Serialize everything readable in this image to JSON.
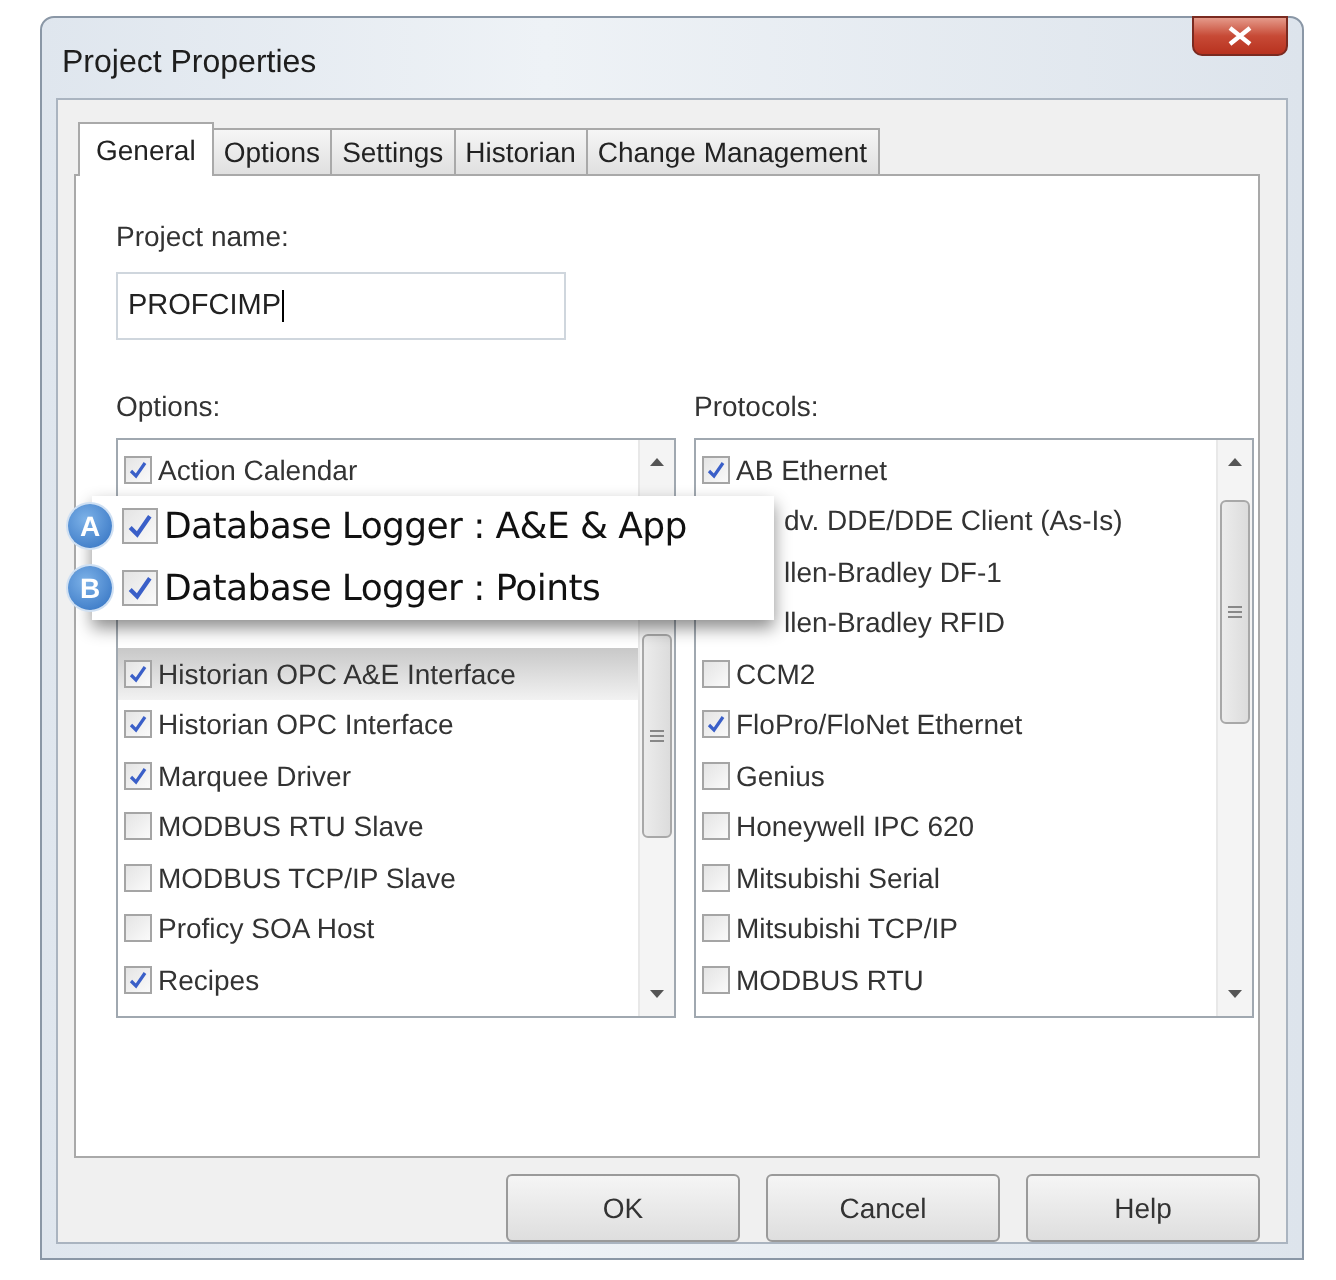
{
  "window": {
    "title": "Project Properties"
  },
  "tabs": [
    {
      "label": "General",
      "selected": true
    },
    {
      "label": "Options",
      "selected": false
    },
    {
      "label": "Settings",
      "selected": false
    },
    {
      "label": "Historian",
      "selected": false
    },
    {
      "label": "Change Management",
      "selected": false
    }
  ],
  "project_name": {
    "label": "Project name:",
    "value": "PROFCIMP"
  },
  "options": {
    "label": "Options:",
    "items": [
      {
        "kind": "item",
        "label": "Action Calendar",
        "checked": true
      },
      {
        "kind": "callout",
        "entries": [
          {
            "badge": "A",
            "label": "Database Logger : A&E & App",
            "checked": true
          },
          {
            "badge": "B",
            "label": "Database Logger : Points",
            "checked": true
          }
        ]
      },
      {
        "kind": "item",
        "label": "Historian OPC A&E Interface",
        "checked": true,
        "shaded": true
      },
      {
        "kind": "item",
        "label": "Historian OPC Interface",
        "checked": true
      },
      {
        "kind": "item",
        "label": "Marquee Driver",
        "checked": true
      },
      {
        "kind": "item",
        "label": "MODBUS RTU Slave",
        "checked": false
      },
      {
        "kind": "item",
        "label": "MODBUS TCP/IP Slave",
        "checked": false
      },
      {
        "kind": "item",
        "label": "Proficy SOA Host",
        "checked": false
      },
      {
        "kind": "item",
        "label": "Recipes",
        "checked": true
      }
    ]
  },
  "protocols": {
    "label": "Protocols:",
    "items": [
      {
        "kind": "item",
        "label": "AB Ethernet",
        "checked": true
      },
      {
        "kind": "covered",
        "label": "dv. DDE/DDE Client (As-Is)"
      },
      {
        "kind": "covered",
        "label": "llen-Bradley DF-1"
      },
      {
        "kind": "covered",
        "label": "llen-Bradley RFID"
      },
      {
        "kind": "item",
        "label": "CCM2",
        "checked": false
      },
      {
        "kind": "item",
        "label": "FloPro/FloNet Ethernet",
        "checked": true
      },
      {
        "kind": "item",
        "label": "Genius",
        "checked": false
      },
      {
        "kind": "item",
        "label": "Honeywell IPC 620",
        "checked": false
      },
      {
        "kind": "item",
        "label": "Mitsubishi Serial",
        "checked": false
      },
      {
        "kind": "item",
        "label": "Mitsubishi TCP/IP",
        "checked": false
      },
      {
        "kind": "item",
        "label": "MODBUS RTU",
        "checked": false
      }
    ]
  },
  "buttons": [
    "OK",
    "Cancel",
    "Help"
  ]
}
